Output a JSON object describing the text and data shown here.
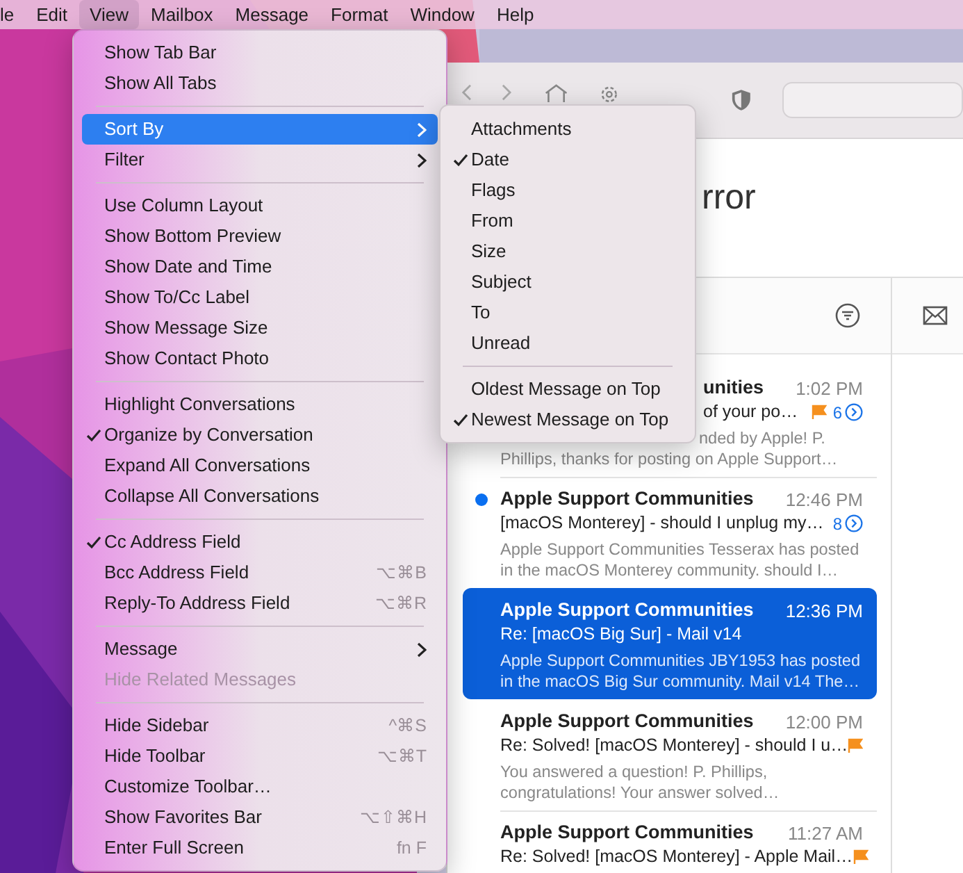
{
  "menu_bar": [
    {
      "label": "le",
      "selected": false
    },
    {
      "label": "Edit",
      "selected": false
    },
    {
      "label": "View",
      "selected": true
    },
    {
      "label": "Mailbox",
      "selected": false
    },
    {
      "label": "Message",
      "selected": false
    },
    {
      "label": "Format",
      "selected": false
    },
    {
      "label": "Window",
      "selected": false
    },
    {
      "label": "Help",
      "selected": false
    }
  ],
  "view_menu": [
    {
      "kind": "item",
      "label": "Show Tab Bar",
      "checked": false,
      "selected": false,
      "disabled": false,
      "submenu": false
    },
    {
      "kind": "item",
      "label": "Show All Tabs",
      "checked": false,
      "selected": false,
      "disabled": false,
      "submenu": false
    },
    {
      "kind": "separator"
    },
    {
      "kind": "item",
      "label": "Sort By",
      "checked": false,
      "selected": true,
      "disabled": false,
      "submenu": true
    },
    {
      "kind": "item",
      "label": "Filter",
      "checked": false,
      "selected": false,
      "disabled": false,
      "submenu": true
    },
    {
      "kind": "separator"
    },
    {
      "kind": "item",
      "label": "Use Column Layout",
      "checked": false,
      "selected": false,
      "disabled": false,
      "submenu": false
    },
    {
      "kind": "item",
      "label": "Show Bottom Preview",
      "checked": false,
      "selected": false,
      "disabled": false,
      "submenu": false
    },
    {
      "kind": "item",
      "label": "Show Date and Time",
      "checked": false,
      "selected": false,
      "disabled": false,
      "submenu": false
    },
    {
      "kind": "item",
      "label": "Show To/Cc Label",
      "checked": false,
      "selected": false,
      "disabled": false,
      "submenu": false
    },
    {
      "kind": "item",
      "label": "Show Message Size",
      "checked": false,
      "selected": false,
      "disabled": false,
      "submenu": false
    },
    {
      "kind": "item",
      "label": "Show Contact Photo",
      "checked": false,
      "selected": false,
      "disabled": false,
      "submenu": false
    },
    {
      "kind": "separator"
    },
    {
      "kind": "item",
      "label": "Highlight Conversations",
      "checked": false,
      "selected": false,
      "disabled": false,
      "submenu": false
    },
    {
      "kind": "item",
      "label": "Organize by Conversation",
      "checked": true,
      "selected": false,
      "disabled": false,
      "submenu": false
    },
    {
      "kind": "item",
      "label": "Expand All Conversations",
      "checked": false,
      "selected": false,
      "disabled": false,
      "submenu": false
    },
    {
      "kind": "item",
      "label": "Collapse All Conversations",
      "checked": false,
      "selected": false,
      "disabled": false,
      "submenu": false
    },
    {
      "kind": "separator"
    },
    {
      "kind": "item",
      "label": "Cc Address Field",
      "checked": true,
      "selected": false,
      "disabled": false,
      "submenu": false
    },
    {
      "kind": "item",
      "label": "Bcc Address Field",
      "shortcut": "⌥⌘B",
      "checked": false,
      "selected": false,
      "disabled": false,
      "submenu": false
    },
    {
      "kind": "item",
      "label": "Reply-To Address Field",
      "shortcut": "⌥⌘R",
      "checked": false,
      "selected": false,
      "disabled": false,
      "submenu": false
    },
    {
      "kind": "separator"
    },
    {
      "kind": "item",
      "label": "Message",
      "checked": false,
      "selected": false,
      "disabled": false,
      "submenu": true
    },
    {
      "kind": "item",
      "label": "Hide Related Messages",
      "checked": false,
      "selected": false,
      "disabled": true,
      "submenu": false
    },
    {
      "kind": "separator"
    },
    {
      "kind": "item",
      "label": "Hide Sidebar",
      "shortcut": "^⌘S",
      "checked": false,
      "selected": false,
      "disabled": false,
      "submenu": false
    },
    {
      "kind": "item",
      "label": "Hide Toolbar",
      "shortcut": "⌥⌘T",
      "checked": false,
      "selected": false,
      "disabled": false,
      "submenu": false
    },
    {
      "kind": "item",
      "label": "Customize Toolbar…",
      "checked": false,
      "selected": false,
      "disabled": false,
      "submenu": false
    },
    {
      "kind": "item",
      "label": "Show Favorites Bar",
      "shortcut": "⌥⇧⌘H",
      "checked": false,
      "selected": false,
      "disabled": false,
      "submenu": false
    },
    {
      "kind": "item",
      "label": "Enter Full Screen",
      "shortcut": "fn F",
      "checked": false,
      "selected": false,
      "disabled": false,
      "submenu": false
    }
  ],
  "sort_by_menu": [
    {
      "kind": "item",
      "label": "Attachments",
      "checked": false
    },
    {
      "kind": "item",
      "label": "Date",
      "checked": true
    },
    {
      "kind": "item",
      "label": "Flags",
      "checked": false
    },
    {
      "kind": "item",
      "label": "From",
      "checked": false
    },
    {
      "kind": "item",
      "label": "Size",
      "checked": false
    },
    {
      "kind": "item",
      "label": "Subject",
      "checked": false
    },
    {
      "kind": "item",
      "label": "To",
      "checked": false
    },
    {
      "kind": "item",
      "label": "Unread",
      "checked": false
    },
    {
      "kind": "separator"
    },
    {
      "kind": "item",
      "label": "Oldest Message on Top",
      "checked": false
    },
    {
      "kind": "item",
      "label": "Newest Message on Top",
      "checked": true
    }
  ],
  "window": {
    "title": "rror"
  },
  "messages": [
    {
      "kind": "partial",
      "sender": "unities",
      "time": "1:02 PM",
      "subject": "of your po…",
      "count": "6",
      "preview_lines": [
        "nded by Apple! P.",
        "Phillips, thanks for posting on Apple Support…"
      ],
      "unread": false,
      "selected": false,
      "flagged": true
    },
    {
      "kind": "full",
      "sender": "Apple Support Communities",
      "time": "12:46 PM",
      "subject": "[macOS Monterey] - should I unplug my…",
      "count": "8",
      "preview_lines": [
        "Apple Support Communities Tesserax has posted",
        "in the macOS Monterey community. should I…"
      ],
      "unread": true,
      "selected": false,
      "flagged": false
    },
    {
      "kind": "full",
      "sender": "Apple Support Communities",
      "time": "12:36 PM",
      "subject": "Re: [macOS Big Sur] - Mail v14",
      "preview_lines": [
        "Apple Support Communities JBY1953 has posted",
        "in the macOS Big Sur community. Mail v14 The…"
      ],
      "unread": false,
      "selected": true,
      "flagged": false
    },
    {
      "kind": "full",
      "sender": "Apple Support Communities",
      "time": "12:00 PM",
      "subject": "Re: Solved! [macOS Monterey] - should I u…",
      "preview_lines": [
        "You answered a question! P. Phillips,",
        "congratulations! Your answer solved…"
      ],
      "unread": false,
      "selected": false,
      "flagged": true
    },
    {
      "kind": "full",
      "sender": "Apple Support Communities",
      "time": "11:27 AM",
      "subject": "Re: Solved! [macOS Monterey] - Apple Mail…",
      "unread": false,
      "selected": false,
      "flagged": true
    }
  ]
}
